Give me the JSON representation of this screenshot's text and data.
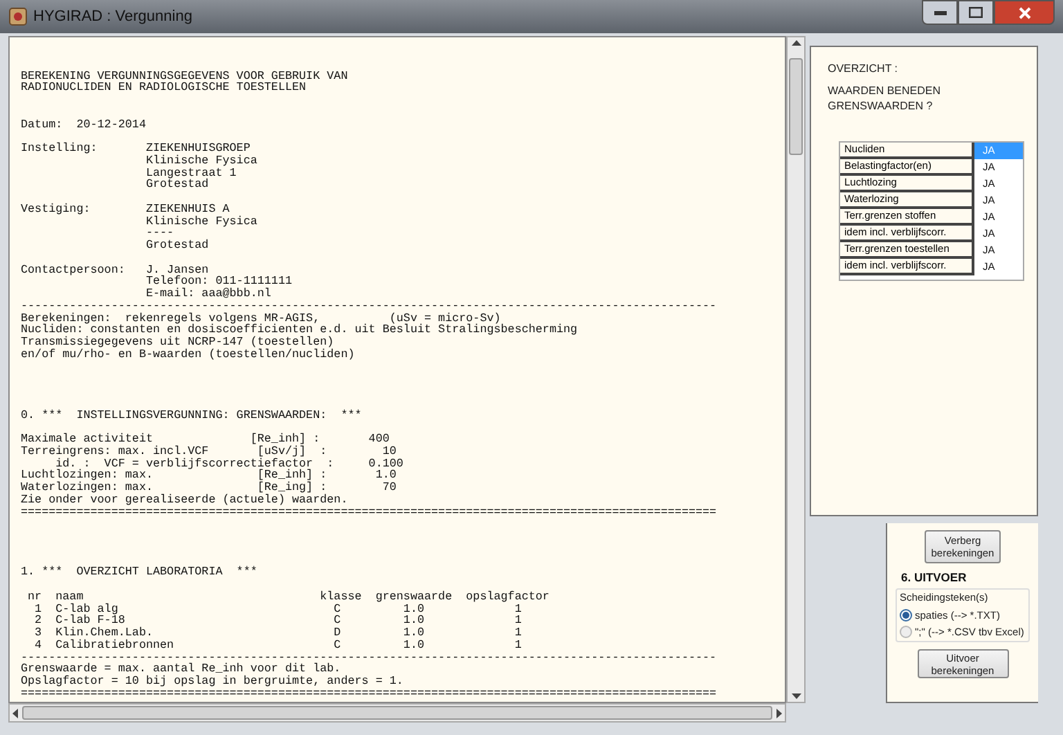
{
  "window": {
    "title": "HYGIRAD : Vergunning"
  },
  "report_lines": [
    {
      "kind": "blank"
    },
    {
      "kind": "blank"
    },
    {
      "kind": "text",
      "text": "BEREKENING VERGUNNINGSGEGEVENS VOOR GEBRUIK VAN"
    },
    {
      "kind": "text",
      "text": "RADIONUCLIDEN EN RADIOLOGISCHE TOESTELLEN"
    },
    {
      "kind": "blank"
    },
    {
      "kind": "blank"
    },
    {
      "kind": "text",
      "text": "Datum:  20-12-2014"
    },
    {
      "kind": "blank"
    },
    {
      "kind": "text",
      "text": "Instelling:       ZIEKENHUISGROEP"
    },
    {
      "kind": "text",
      "text": "                  Klinische Fysica"
    },
    {
      "kind": "text",
      "text": "                  Langestraat 1"
    },
    {
      "kind": "text",
      "text": "                  Grotestad"
    },
    {
      "kind": "blank"
    },
    {
      "kind": "text",
      "text": "Vestiging:        ZIEKENHUIS A"
    },
    {
      "kind": "text",
      "text": "                  Klinische Fysica"
    },
    {
      "kind": "text",
      "text": "                  ----"
    },
    {
      "kind": "text",
      "text": "                  Grotestad"
    },
    {
      "kind": "blank"
    },
    {
      "kind": "text",
      "text": "Contactpersoon:   J. Jansen"
    },
    {
      "kind": "text",
      "text": "                  Telefoon: 011-1111111"
    },
    {
      "kind": "text",
      "text": "                  E-mail: aaa@bbb.nl"
    },
    {
      "kind": "text",
      "text": "----------------------------------------------------------------------------------------------------"
    },
    {
      "kind": "text",
      "text": "Berekeningen:  rekenregels volgens MR-AGIS,          (uSv = micro-Sv)"
    },
    {
      "kind": "text",
      "text": "Nucliden: constanten en dosiscoefficienten e.d. uit Besluit Stralingsbescherming"
    },
    {
      "kind": "text",
      "text": "Transmissiegegevens uit NCRP-147 (toestellen)"
    },
    {
      "kind": "text",
      "text": "en/of mu/rho- en B-waarden (toestellen/nucliden)"
    },
    {
      "kind": "blank"
    },
    {
      "kind": "blank"
    },
    {
      "kind": "blank"
    },
    {
      "kind": "blank"
    },
    {
      "kind": "text",
      "text": "0. ***  INSTELLINGSVERGUNNING: GRENSWAARDEN:  ***"
    },
    {
      "kind": "blank"
    },
    {
      "kind": "text",
      "text": "Maximale activiteit              [Re_inh] :       400"
    },
    {
      "kind": "text",
      "text": "Terreingrens: max. incl.VCF       [uSv/j]  :        10"
    },
    {
      "kind": "text",
      "text": "     id. :  VCF = verblijfscorrectiefactor  :     0.100"
    },
    {
      "kind": "text",
      "text": "Luchtlozingen: max.               [Re_inh] :       1.0"
    },
    {
      "kind": "text",
      "text": "Waterlozingen: max.               [Re_ing] :        70"
    },
    {
      "kind": "text",
      "text": "Zie onder voor gerealiseerde (actuele) waarden."
    },
    {
      "kind": "text",
      "text": "===================================================================================================="
    },
    {
      "kind": "blank"
    },
    {
      "kind": "blank"
    },
    {
      "kind": "blank"
    },
    {
      "kind": "blank"
    },
    {
      "kind": "text",
      "text": "1. ***  OVERZICHT LABORATORIA  ***"
    },
    {
      "kind": "blank"
    },
    {
      "kind": "text",
      "text": " nr  naam                                  klasse  grenswaarde  opslagfactor"
    },
    {
      "kind": "text",
      "text": "  1  C-lab alg                               C         1.0             1"
    },
    {
      "kind": "text",
      "text": "  2  C-lab F-18                              C         1.0             1"
    },
    {
      "kind": "text",
      "text": "  3  Klin.Chem.Lab.                          D         1.0             1"
    },
    {
      "kind": "text",
      "text": "  4  Calibratiebronnen                       C         1.0             1"
    },
    {
      "kind": "text",
      "text": "----------------------------------------------------------------------------------------------------"
    },
    {
      "kind": "text",
      "text": "Grenswaarde = max. aantal Re_inh voor dit lab."
    },
    {
      "kind": "text",
      "text": "Opslagfactor = 10 bij opslag in bergruimte, anders = 1."
    },
    {
      "kind": "text",
      "text": "===================================================================================================="
    }
  ],
  "overview": {
    "heading": "OVERZICHT :",
    "question": "WAARDEN BENEDEN GRENSWAARDEN ?",
    "rows": [
      {
        "label": "Nucliden",
        "value": "JA",
        "selected": true
      },
      {
        "label": "Belastingfactor(en)",
        "value": "JA",
        "selected": false
      },
      {
        "label": "Luchtlozing",
        "value": "JA",
        "selected": false
      },
      {
        "label": "Waterlozing",
        "value": "JA",
        "selected": false
      },
      {
        "label": "Terr.grenzen stoffen",
        "value": "JA",
        "selected": false
      },
      {
        "label": "idem incl. verblijfscorr.",
        "value": "JA",
        "selected": false
      },
      {
        "label": "Terr.grenzen toestellen",
        "value": "JA",
        "selected": false
      },
      {
        "label": "idem incl. verblijfscorr.",
        "value": "JA",
        "selected": false
      }
    ]
  },
  "hide_button": "Verberg berekeningen",
  "output": {
    "title": "6. UITVOER",
    "group": "Scheidingsteken(s)",
    "options": [
      {
        "label": "spaties (--> *.TXT)",
        "selected": true
      },
      {
        "label": "\";\" (--> *.CSV tbv Excel)",
        "selected": false
      }
    ],
    "button": "Uitvoer berekeningen"
  }
}
